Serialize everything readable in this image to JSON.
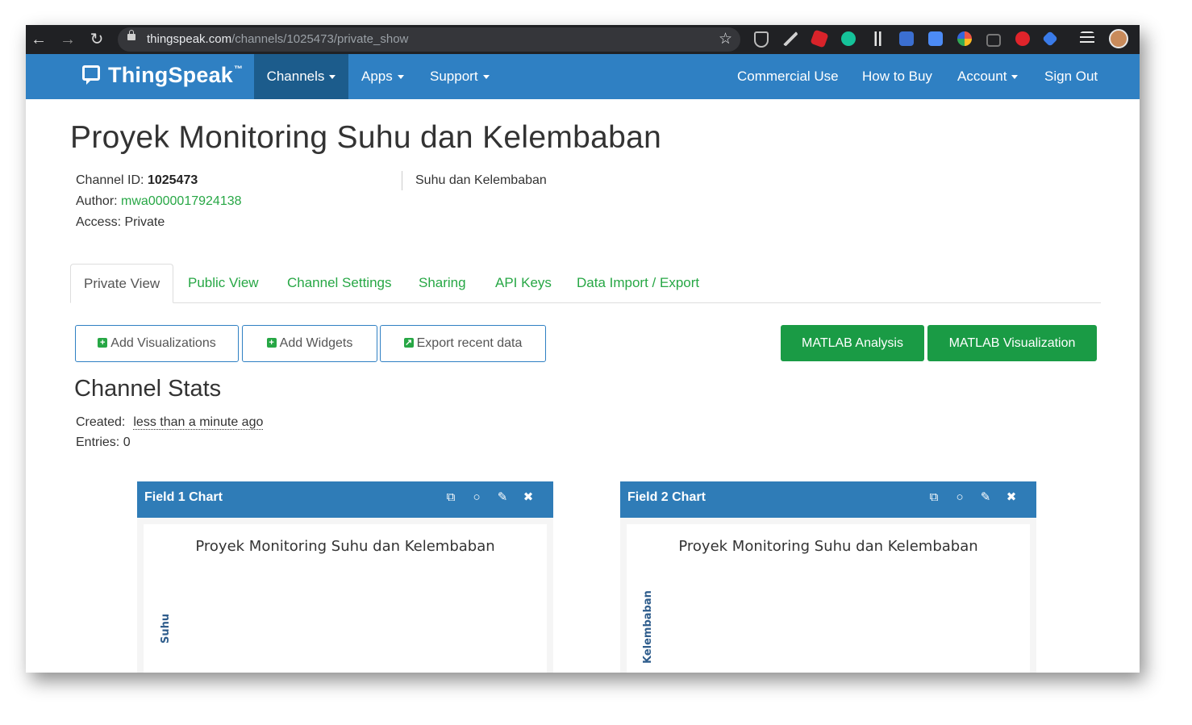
{
  "browser": {
    "url_host": "thingspeak.com",
    "url_path": "/channels/1025473/private_show"
  },
  "nav": {
    "brand": "ThingSpeak",
    "brand_tm": "™",
    "items": [
      "Channels",
      "Apps",
      "Support"
    ],
    "right_items": [
      "Commercial Use",
      "How to Buy",
      "Account",
      "Sign Out"
    ]
  },
  "channel": {
    "title": "Proyek Monitoring Suhu dan Kelembaban",
    "id_label": "Channel ID:",
    "id_value": "1025473",
    "author_label": "Author:",
    "author_value": "mwa0000017924138",
    "access_label": "Access:",
    "access_value": "Private",
    "description": "Suhu dan Kelembaban"
  },
  "tabs": [
    "Private View",
    "Public View",
    "Channel Settings",
    "Sharing",
    "API Keys",
    "Data Import / Export"
  ],
  "buttons": {
    "add_visualizations": "Add Visualizations",
    "add_widgets": "Add Widgets",
    "export_recent": "Export recent data",
    "matlab_analysis": "MATLAB Analysis",
    "matlab_visualization": "MATLAB Visualization"
  },
  "stats": {
    "title": "Channel Stats",
    "created_label": "Created:",
    "created_value": "less than a minute ago",
    "entries_label": "Entries:",
    "entries_value": "0"
  },
  "charts": [
    {
      "panel_title": "Field 1 Chart",
      "chart_title": "Proyek Monitoring Suhu dan Kelembaban",
      "ylabel": "Suhu"
    },
    {
      "panel_title": "Field 2 Chart",
      "chart_title": "Proyek Monitoring Suhu dan Kelembaban",
      "ylabel": "Kelembaban"
    }
  ],
  "colors": {
    "nav_blue": "#2f80c3",
    "nav_active": "#1c5c8c",
    "link_green": "#27a745",
    "button_green": "#1a9b45",
    "panel_head": "#2f7cb7"
  }
}
